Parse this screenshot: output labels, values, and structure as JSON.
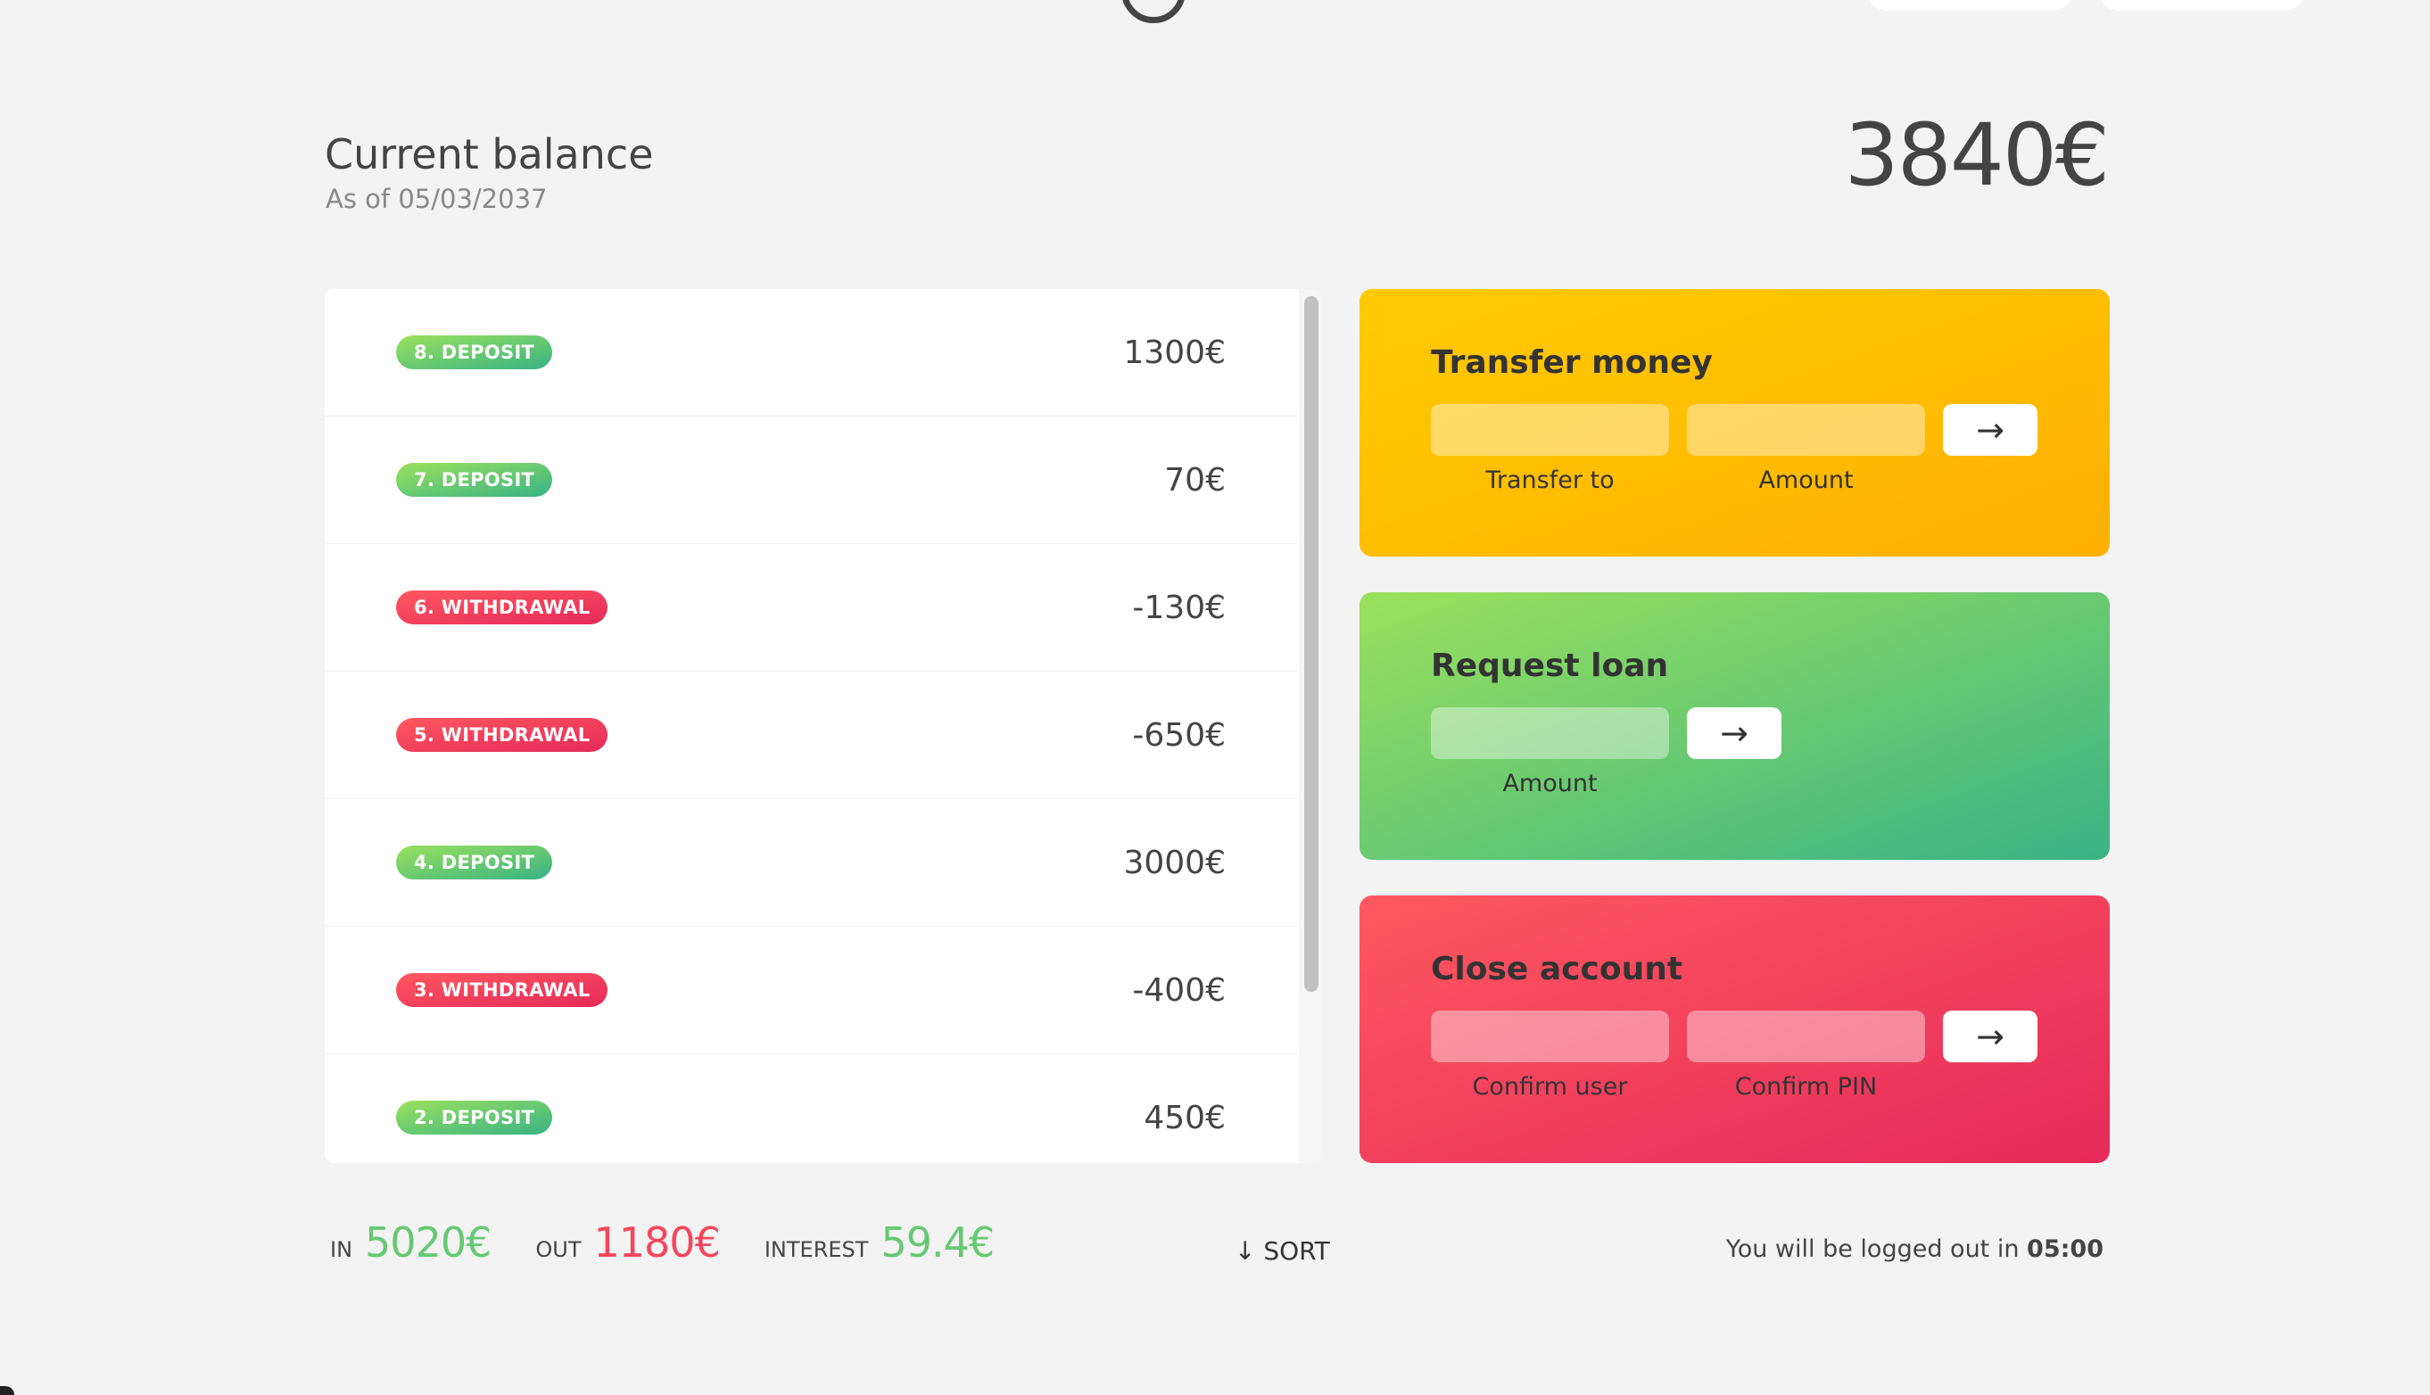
{
  "balance": {
    "label": "Current balance",
    "date": "As of 05/03/2037",
    "value": "3840€"
  },
  "movements": [
    {
      "type": "8. DEPOSIT",
      "kind": "deposit",
      "value": "1300€"
    },
    {
      "type": "7. DEPOSIT",
      "kind": "deposit",
      "value": "70€"
    },
    {
      "type": "6. WITHDRAWAL",
      "kind": "withdrawal",
      "value": "-130€"
    },
    {
      "type": "5. WITHDRAWAL",
      "kind": "withdrawal",
      "value": "-650€"
    },
    {
      "type": "4. DEPOSIT",
      "kind": "deposit",
      "value": "3000€"
    },
    {
      "type": "3. WITHDRAWAL",
      "kind": "withdrawal",
      "value": "-400€"
    },
    {
      "type": "2. DEPOSIT",
      "kind": "deposit",
      "value": "450€"
    }
  ],
  "operations": {
    "transfer": {
      "title": "Transfer money",
      "field1_label": "Transfer to",
      "field2_label": "Amount",
      "button_label": "→"
    },
    "loan": {
      "title": "Request loan",
      "field1_label": "Amount",
      "button_label": "→"
    },
    "close": {
      "title": "Close account",
      "field1_label": "Confirm user",
      "field2_label": "Confirm PIN",
      "button_label": "→"
    }
  },
  "summary": {
    "in_label": "In",
    "in_value": "5020€",
    "out_label": "Out",
    "out_value": "1180€",
    "interest_label": "Interest",
    "interest_value": "59.4€",
    "sort_label": "↓ SORT"
  },
  "logout": {
    "text": "You will be logged out in ",
    "timer": "05:00"
  },
  "colors": {
    "deposit": "#66c873",
    "withdrawal": "#f5465d",
    "transfer": "#ffc003",
    "background": "#f3f3f3"
  }
}
